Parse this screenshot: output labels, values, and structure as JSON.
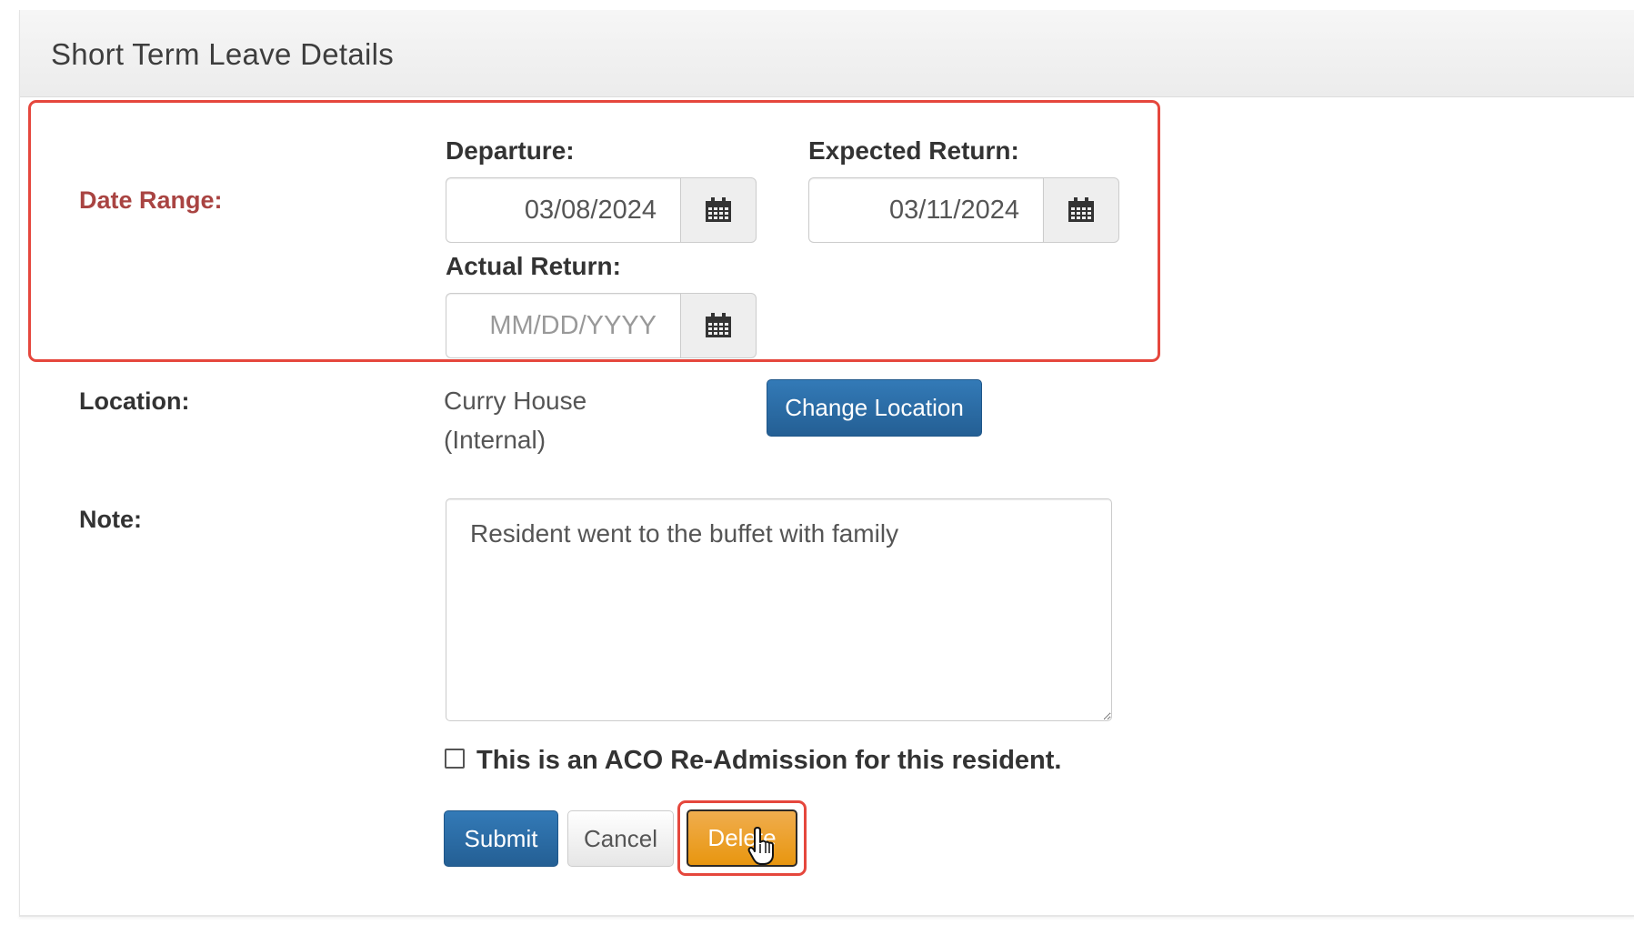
{
  "panel": {
    "title": "Short Term Leave Details"
  },
  "date_range": {
    "label": "Date Range:",
    "departure": {
      "label": "Departure:",
      "value": "03/08/2024",
      "placeholder": "MM/DD/YYYY"
    },
    "expected_return": {
      "label": "Expected Return:",
      "value": "03/11/2024",
      "placeholder": "MM/DD/YYYY"
    },
    "actual_return": {
      "label": "Actual Return:",
      "value": "",
      "placeholder": "MM/DD/YYYY"
    },
    "calendar_icon": "calendar-icon"
  },
  "location": {
    "label": "Location:",
    "name": "Curry House",
    "type": "(Internal)",
    "change_button": "Change Location"
  },
  "note": {
    "label": "Note:",
    "value": "Resident went to the buffet with family"
  },
  "aco_checkbox": {
    "label": "This is an ACO Re-Admission for this resident.",
    "checked": false
  },
  "actions": {
    "submit": "Submit",
    "cancel": "Cancel",
    "delete": "Delete"
  },
  "colors": {
    "primary": "#337ab7",
    "warning": "#f0ad4e",
    "required_label": "#a94442",
    "highlight": "#e5473d"
  }
}
